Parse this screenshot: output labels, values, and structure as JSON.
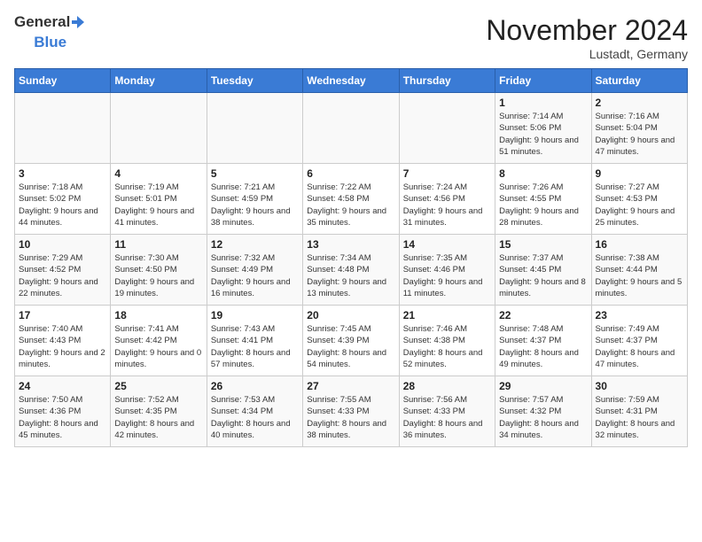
{
  "logo": {
    "text_general": "General",
    "text_blue": "Blue"
  },
  "header": {
    "month": "November 2024",
    "location": "Lustadt, Germany"
  },
  "weekdays": [
    "Sunday",
    "Monday",
    "Tuesday",
    "Wednesday",
    "Thursday",
    "Friday",
    "Saturday"
  ],
  "weeks": [
    [
      {
        "day": "",
        "info": ""
      },
      {
        "day": "",
        "info": ""
      },
      {
        "day": "",
        "info": ""
      },
      {
        "day": "",
        "info": ""
      },
      {
        "day": "",
        "info": ""
      },
      {
        "day": "1",
        "info": "Sunrise: 7:14 AM\nSunset: 5:06 PM\nDaylight: 9 hours and 51 minutes."
      },
      {
        "day": "2",
        "info": "Sunrise: 7:16 AM\nSunset: 5:04 PM\nDaylight: 9 hours and 47 minutes."
      }
    ],
    [
      {
        "day": "3",
        "info": "Sunrise: 7:18 AM\nSunset: 5:02 PM\nDaylight: 9 hours and 44 minutes."
      },
      {
        "day": "4",
        "info": "Sunrise: 7:19 AM\nSunset: 5:01 PM\nDaylight: 9 hours and 41 minutes."
      },
      {
        "day": "5",
        "info": "Sunrise: 7:21 AM\nSunset: 4:59 PM\nDaylight: 9 hours and 38 minutes."
      },
      {
        "day": "6",
        "info": "Sunrise: 7:22 AM\nSunset: 4:58 PM\nDaylight: 9 hours and 35 minutes."
      },
      {
        "day": "7",
        "info": "Sunrise: 7:24 AM\nSunset: 4:56 PM\nDaylight: 9 hours and 31 minutes."
      },
      {
        "day": "8",
        "info": "Sunrise: 7:26 AM\nSunset: 4:55 PM\nDaylight: 9 hours and 28 minutes."
      },
      {
        "day": "9",
        "info": "Sunrise: 7:27 AM\nSunset: 4:53 PM\nDaylight: 9 hours and 25 minutes."
      }
    ],
    [
      {
        "day": "10",
        "info": "Sunrise: 7:29 AM\nSunset: 4:52 PM\nDaylight: 9 hours and 22 minutes."
      },
      {
        "day": "11",
        "info": "Sunrise: 7:30 AM\nSunset: 4:50 PM\nDaylight: 9 hours and 19 minutes."
      },
      {
        "day": "12",
        "info": "Sunrise: 7:32 AM\nSunset: 4:49 PM\nDaylight: 9 hours and 16 minutes."
      },
      {
        "day": "13",
        "info": "Sunrise: 7:34 AM\nSunset: 4:48 PM\nDaylight: 9 hours and 13 minutes."
      },
      {
        "day": "14",
        "info": "Sunrise: 7:35 AM\nSunset: 4:46 PM\nDaylight: 9 hours and 11 minutes."
      },
      {
        "day": "15",
        "info": "Sunrise: 7:37 AM\nSunset: 4:45 PM\nDaylight: 9 hours and 8 minutes."
      },
      {
        "day": "16",
        "info": "Sunrise: 7:38 AM\nSunset: 4:44 PM\nDaylight: 9 hours and 5 minutes."
      }
    ],
    [
      {
        "day": "17",
        "info": "Sunrise: 7:40 AM\nSunset: 4:43 PM\nDaylight: 9 hours and 2 minutes."
      },
      {
        "day": "18",
        "info": "Sunrise: 7:41 AM\nSunset: 4:42 PM\nDaylight: 9 hours and 0 minutes."
      },
      {
        "day": "19",
        "info": "Sunrise: 7:43 AM\nSunset: 4:41 PM\nDaylight: 8 hours and 57 minutes."
      },
      {
        "day": "20",
        "info": "Sunrise: 7:45 AM\nSunset: 4:39 PM\nDaylight: 8 hours and 54 minutes."
      },
      {
        "day": "21",
        "info": "Sunrise: 7:46 AM\nSunset: 4:38 PM\nDaylight: 8 hours and 52 minutes."
      },
      {
        "day": "22",
        "info": "Sunrise: 7:48 AM\nSunset: 4:37 PM\nDaylight: 8 hours and 49 minutes."
      },
      {
        "day": "23",
        "info": "Sunrise: 7:49 AM\nSunset: 4:37 PM\nDaylight: 8 hours and 47 minutes."
      }
    ],
    [
      {
        "day": "24",
        "info": "Sunrise: 7:50 AM\nSunset: 4:36 PM\nDaylight: 8 hours and 45 minutes."
      },
      {
        "day": "25",
        "info": "Sunrise: 7:52 AM\nSunset: 4:35 PM\nDaylight: 8 hours and 42 minutes."
      },
      {
        "day": "26",
        "info": "Sunrise: 7:53 AM\nSunset: 4:34 PM\nDaylight: 8 hours and 40 minutes."
      },
      {
        "day": "27",
        "info": "Sunrise: 7:55 AM\nSunset: 4:33 PM\nDaylight: 8 hours and 38 minutes."
      },
      {
        "day": "28",
        "info": "Sunrise: 7:56 AM\nSunset: 4:33 PM\nDaylight: 8 hours and 36 minutes."
      },
      {
        "day": "29",
        "info": "Sunrise: 7:57 AM\nSunset: 4:32 PM\nDaylight: 8 hours and 34 minutes."
      },
      {
        "day": "30",
        "info": "Sunrise: 7:59 AM\nSunset: 4:31 PM\nDaylight: 8 hours and 32 minutes."
      }
    ]
  ]
}
